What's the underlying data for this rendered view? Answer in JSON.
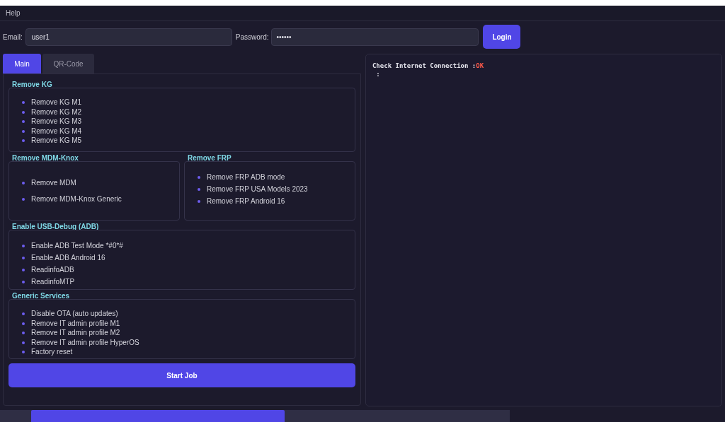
{
  "menu": [
    {
      "label": "Help"
    }
  ],
  "login": {
    "email_label": "Email:",
    "email": "user1",
    "password_label": "Password:",
    "password": "••••••",
    "button": "Login"
  },
  "tabs": [
    {
      "label": "Main",
      "selected": true
    },
    {
      "label": "QR-Code",
      "selected": false
    }
  ],
  "group_rows": [
    {
      "groups": [
        {
          "title": "Remove KG",
          "kind": "compact",
          "items": [
            "Remove KG M1",
            "Remove KG M2",
            "Remove KG M3",
            "Remove KG M4",
            "Remove KG M5"
          ]
        }
      ]
    },
    {
      "groups": [
        {
          "title": "Remove MDM-Knox",
          "kind": "wide",
          "items": [
            "Remove MDM",
            "Remove MDM-Knox Generic"
          ]
        },
        {
          "title": "Remove FRP",
          "kind": "spaced",
          "items": [
            "Remove FRP ADB mode",
            "Remove FRP USA Models 2023",
            "Remove FRP Android 16"
          ]
        }
      ]
    },
    {
      "groups": [
        {
          "title": "Enable USB-Debug (ADB)",
          "kind": "spaced",
          "items": [
            "Enable ADB Test Mode *#0*#",
            "Enable ADB Android 16",
            "ReadinfoADB",
            "ReadinfoMTP"
          ]
        }
      ]
    },
    {
      "groups": [
        {
          "title": "Generic Services",
          "kind": "compact",
          "items": [
            "Disable OTA (auto updates)",
            "Remove IT admin profile M1",
            "Remove IT admin profile M2",
            "Remove IT admin profile HyperOS",
            "Factory reset"
          ]
        }
      ]
    }
  ],
  "start_button": "Start Job",
  "log": [
    {
      "text": "Check Internet Connection :",
      "status": "OK"
    },
    {
      "text": " :"
    }
  ],
  "progress": {
    "level": 0.53
  }
}
